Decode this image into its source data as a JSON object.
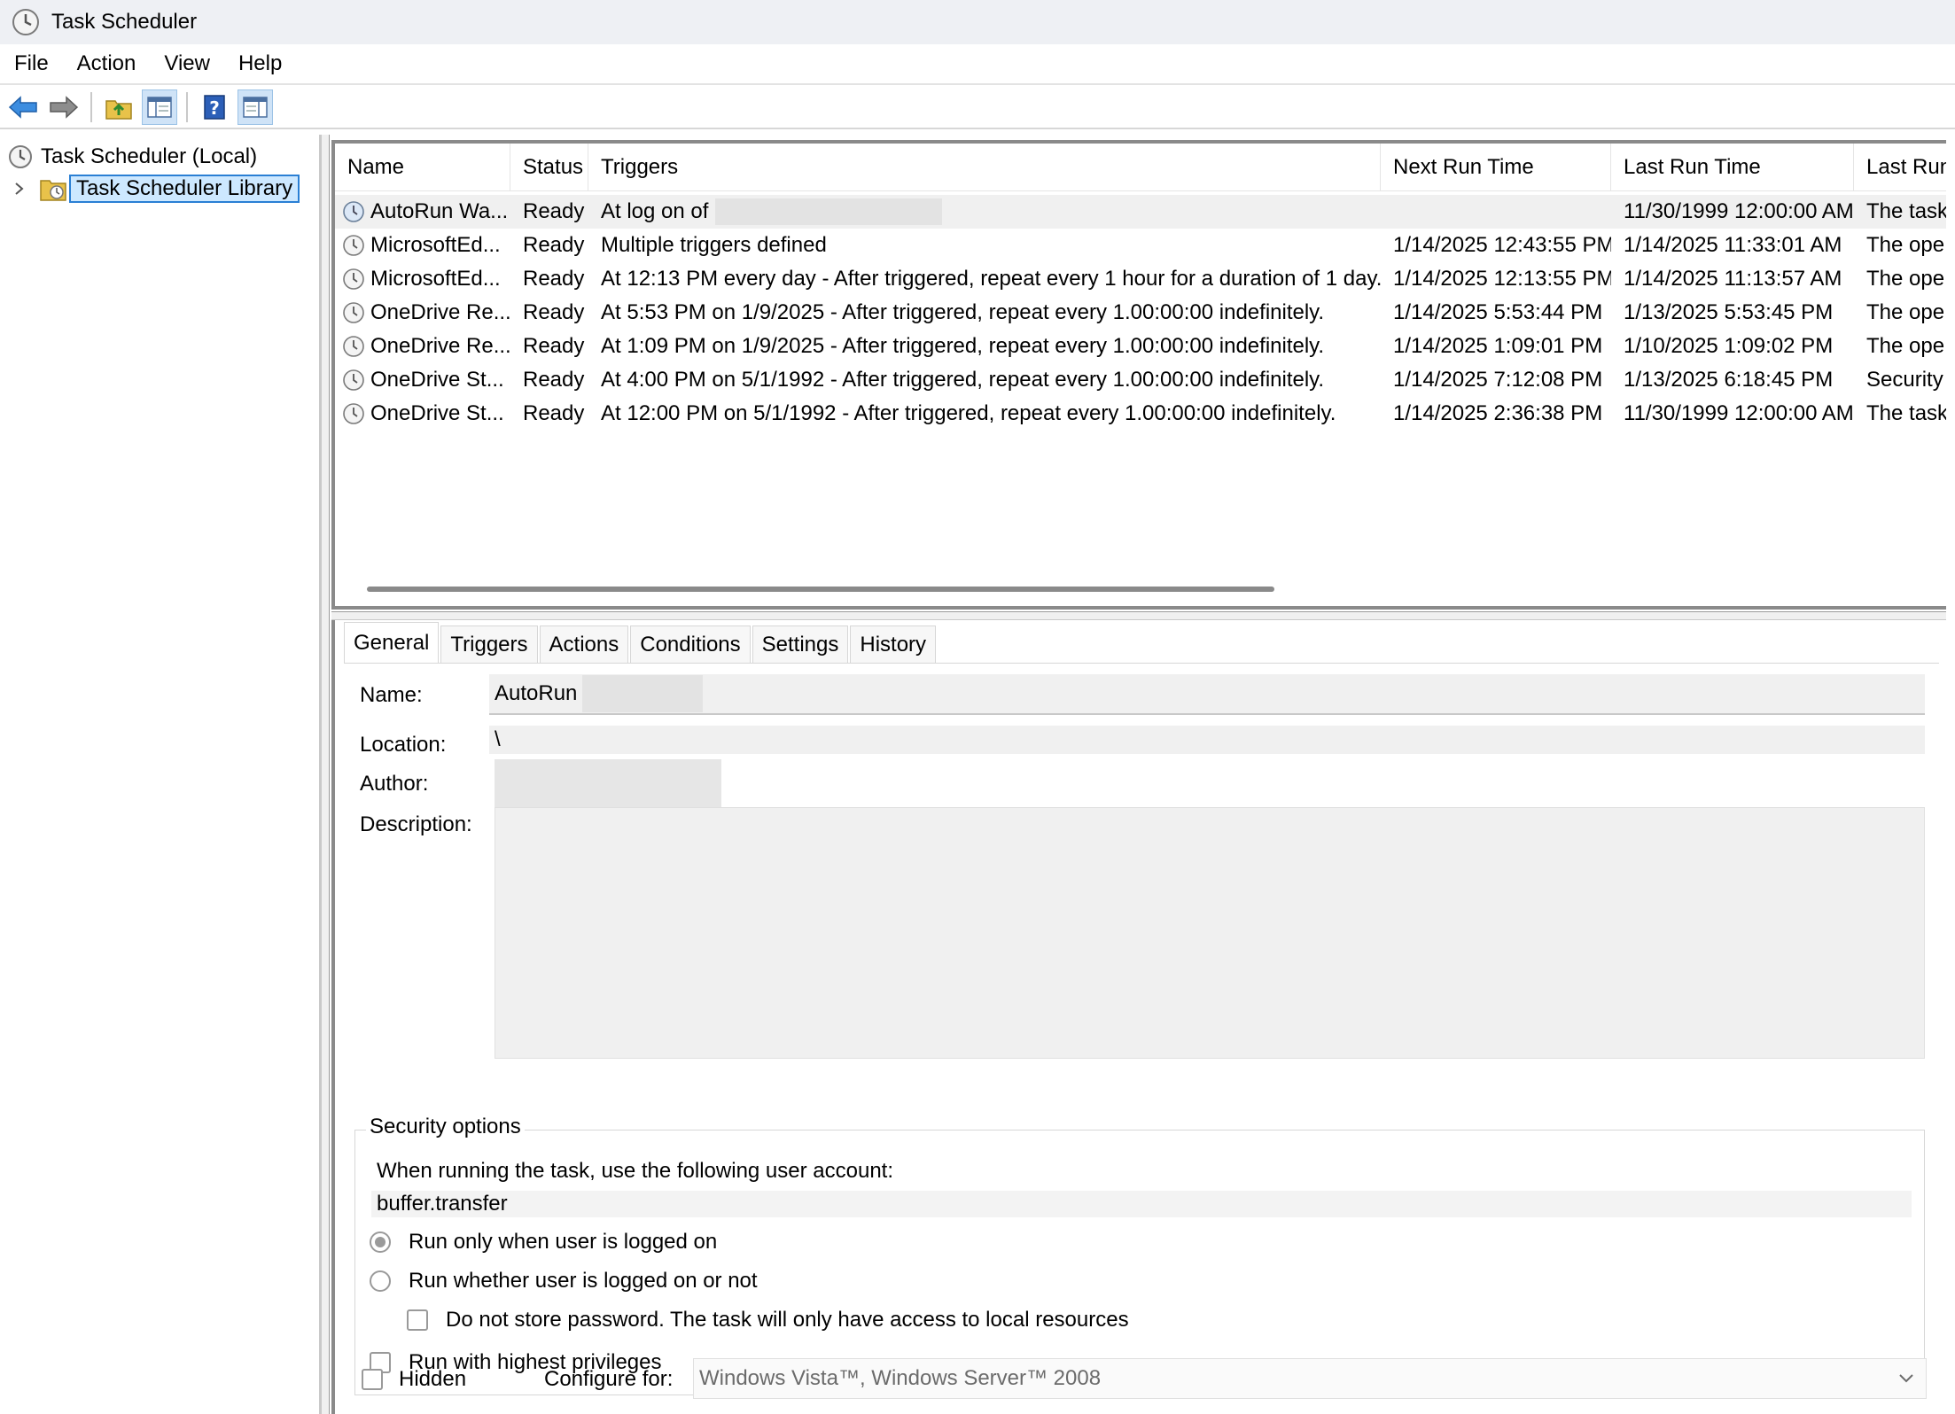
{
  "window": {
    "title": "Task Scheduler"
  },
  "menu": [
    "File",
    "Action",
    "View",
    "Help"
  ],
  "toolbar": {
    "buttons": [
      "back-icon",
      "forward-icon",
      "up-folder-icon",
      "show-hide-console-tree-icon",
      "help-icon",
      "show-hide-action-pane-icon"
    ]
  },
  "tree": {
    "root": "Task Scheduler (Local)",
    "library": "Task Scheduler Library"
  },
  "tasklist": {
    "columns": [
      "Name",
      "Status",
      "Triggers",
      "Next Run Time",
      "Last Run Time",
      "Last Run"
    ],
    "rows": [
      {
        "name": "AutoRun Wa...",
        "status": "Ready",
        "triggers": "At log on of",
        "next": "",
        "last": "11/30/1999 12:00:00 AM",
        "result": "The task"
      },
      {
        "name": "MicrosoftEd...",
        "status": "Ready",
        "triggers": "Multiple triggers defined",
        "next": "1/14/2025 12:43:55 PM",
        "last": "1/14/2025 11:33:01 AM",
        "result": "The ope"
      },
      {
        "name": "MicrosoftEd...",
        "status": "Ready",
        "triggers": "At 12:13 PM every day - After triggered, repeat every 1 hour for a duration of 1 day.",
        "next": "1/14/2025 12:13:55 PM",
        "last": "1/14/2025 11:13:57 AM",
        "result": "The ope"
      },
      {
        "name": "OneDrive Re...",
        "status": "Ready",
        "triggers": "At 5:53 PM on 1/9/2025 - After triggered, repeat every 1.00:00:00 indefinitely.",
        "next": "1/14/2025 5:53:44 PM",
        "last": "1/13/2025 5:53:45 PM",
        "result": "The ope"
      },
      {
        "name": "OneDrive Re...",
        "status": "Ready",
        "triggers": "At 1:09 PM on 1/9/2025 - After triggered, repeat every 1.00:00:00 indefinitely.",
        "next": "1/14/2025 1:09:01 PM",
        "last": "1/10/2025 1:09:02 PM",
        "result": "The ope"
      },
      {
        "name": "OneDrive St...",
        "status": "Ready",
        "triggers": "At 4:00 PM on 5/1/1992 - After triggered, repeat every 1.00:00:00 indefinitely.",
        "next": "1/14/2025 7:12:08 PM",
        "last": "1/13/2025 6:18:45 PM",
        "result": "Security"
      },
      {
        "name": "OneDrive St...",
        "status": "Ready",
        "triggers": "At 12:00 PM on 5/1/1992 - After triggered, repeat every 1.00:00:00 indefinitely.",
        "next": "1/14/2025 2:36:38 PM",
        "last": "11/30/1999 12:00:00 AM",
        "result": "The task"
      }
    ]
  },
  "detail": {
    "tabs": [
      "General",
      "Triggers",
      "Actions",
      "Conditions",
      "Settings",
      "History"
    ],
    "general": {
      "name_label": "Name:",
      "name_value": "AutoRun",
      "location_label": "Location:",
      "location_value": "\\",
      "author_label": "Author:",
      "description_label": "Description:",
      "security": {
        "legend": "Security options",
        "account_prompt": "When running the task, use the following user account:",
        "account": "buffer.transfer",
        "run_logged_on": "Run only when user is logged on",
        "run_whether": "Run whether user is logged on or not",
        "no_store_pw": "Do not store password.  The task will only have access to local resources",
        "highest": "Run with highest privileges"
      },
      "hidden_label": "Hidden",
      "configure_label": "Configure for:",
      "configure_value": "Windows Vista™, Windows Server™ 2008"
    }
  }
}
